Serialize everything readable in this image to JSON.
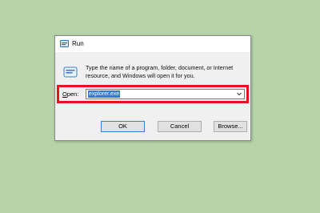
{
  "window": {
    "title": "Run",
    "icon": "run-icon"
  },
  "description": {
    "line1": "Type the name of a program, folder, document, or Internet",
    "line2": "resource, and Windows will open it for you."
  },
  "open": {
    "label_accel": "O",
    "label_rest": "pen:",
    "value": "explorer.exe",
    "dropdown_icon": "chevron-down-icon"
  },
  "buttons": {
    "ok": "OK",
    "cancel": "Cancel",
    "browse": "Browse..."
  },
  "colors": {
    "background": "#b6d4a8",
    "highlight_box": "#e3141e",
    "selection": "#3378d4"
  }
}
